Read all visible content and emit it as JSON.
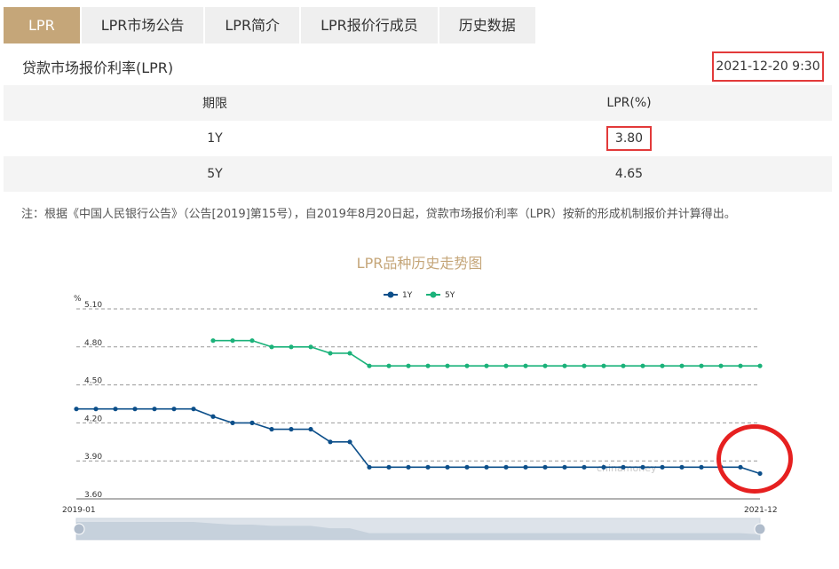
{
  "tabs": [
    {
      "label": "LPR",
      "active": true
    },
    {
      "label": "LPR市场公告"
    },
    {
      "label": "LPR简介"
    },
    {
      "label": "LPR报价行成员"
    },
    {
      "label": "历史数据"
    }
  ],
  "page_title": "贷款市场报价利率(LPR)",
  "date": "2021-12-20 9:30",
  "table": {
    "headers": [
      "期限",
      "LPR(%)"
    ],
    "rows": [
      {
        "term": "1Y",
        "rate": "3.80"
      },
      {
        "term": "5Y",
        "rate": "4.65"
      }
    ]
  },
  "note": "注：根据《中国人民银行公告》（公告[2019]第15号），自2019年8月20日起，贷款市场报价利率（LPR）按新的形成机制报价并计算得出。",
  "watermark": "chinamoney",
  "colors": {
    "accent": "#c5a679",
    "highlight": "#e23a3a",
    "series_1y": "#0c4f8a",
    "series_5y": "#1bb27a"
  },
  "chart_data": {
    "type": "line",
    "title": "LPR品种历史走势图",
    "yunit": "%",
    "ylim": [
      3.6,
      5.1
    ],
    "yticks": [
      "5.10",
      "4.80",
      "4.50",
      "4.20",
      "3.90",
      "3.60"
    ],
    "xticks": [
      "2019-01",
      "2021-12"
    ],
    "legend_position": "top-center",
    "grid": true,
    "series": [
      {
        "name": "1Y",
        "color": "#0c4f8a",
        "values": [
          4.31,
          4.31,
          4.31,
          4.31,
          4.31,
          4.31,
          4.31,
          4.25,
          4.2,
          4.2,
          4.15,
          4.15,
          4.15,
          4.05,
          4.05,
          3.85,
          3.85,
          3.85,
          3.85,
          3.85,
          3.85,
          3.85,
          3.85,
          3.85,
          3.85,
          3.85,
          3.85,
          3.85,
          3.85,
          3.85,
          3.85,
          3.85,
          3.85,
          3.85,
          3.85,
          3.8
        ]
      },
      {
        "name": "5Y",
        "color": "#1bb27a",
        "values": [
          null,
          null,
          null,
          null,
          null,
          null,
          null,
          4.85,
          4.85,
          4.85,
          4.8,
          4.8,
          4.8,
          4.75,
          4.75,
          4.65,
          4.65,
          4.65,
          4.65,
          4.65,
          4.65,
          4.65,
          4.65,
          4.65,
          4.65,
          4.65,
          4.65,
          4.65,
          4.65,
          4.65,
          4.65,
          4.65,
          4.65,
          4.65,
          4.65,
          4.65
        ]
      }
    ]
  }
}
